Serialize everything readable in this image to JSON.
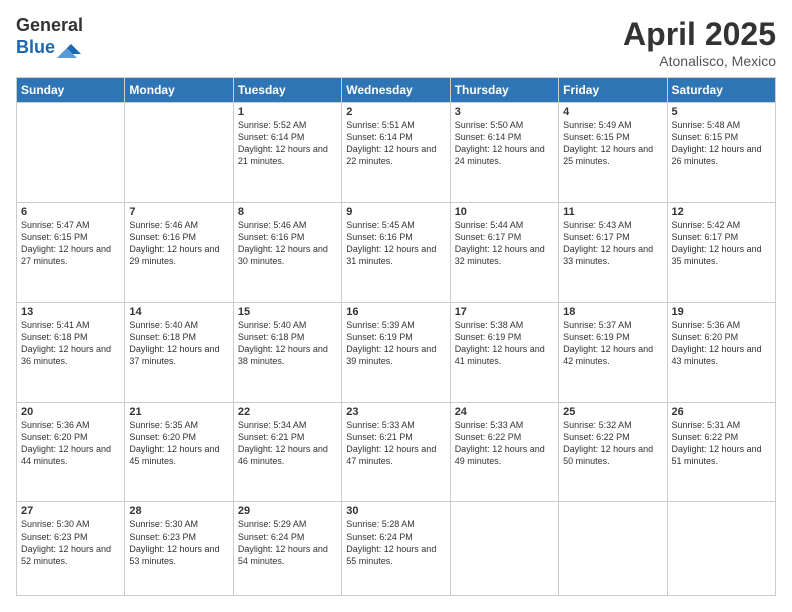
{
  "logo": {
    "general": "General",
    "blue": "Blue"
  },
  "title": {
    "month": "April 2025",
    "location": "Atonalisco, Mexico"
  },
  "weekdays": [
    "Sunday",
    "Monday",
    "Tuesday",
    "Wednesday",
    "Thursday",
    "Friday",
    "Saturday"
  ],
  "weeks": [
    [
      {
        "day": "",
        "info": ""
      },
      {
        "day": "",
        "info": ""
      },
      {
        "day": "1",
        "info": "Sunrise: 5:52 AM\nSunset: 6:14 PM\nDaylight: 12 hours and 21 minutes."
      },
      {
        "day": "2",
        "info": "Sunrise: 5:51 AM\nSunset: 6:14 PM\nDaylight: 12 hours and 22 minutes."
      },
      {
        "day": "3",
        "info": "Sunrise: 5:50 AM\nSunset: 6:14 PM\nDaylight: 12 hours and 24 minutes."
      },
      {
        "day": "4",
        "info": "Sunrise: 5:49 AM\nSunset: 6:15 PM\nDaylight: 12 hours and 25 minutes."
      },
      {
        "day": "5",
        "info": "Sunrise: 5:48 AM\nSunset: 6:15 PM\nDaylight: 12 hours and 26 minutes."
      }
    ],
    [
      {
        "day": "6",
        "info": "Sunrise: 5:47 AM\nSunset: 6:15 PM\nDaylight: 12 hours and 27 minutes."
      },
      {
        "day": "7",
        "info": "Sunrise: 5:46 AM\nSunset: 6:16 PM\nDaylight: 12 hours and 29 minutes."
      },
      {
        "day": "8",
        "info": "Sunrise: 5:46 AM\nSunset: 6:16 PM\nDaylight: 12 hours and 30 minutes."
      },
      {
        "day": "9",
        "info": "Sunrise: 5:45 AM\nSunset: 6:16 PM\nDaylight: 12 hours and 31 minutes."
      },
      {
        "day": "10",
        "info": "Sunrise: 5:44 AM\nSunset: 6:17 PM\nDaylight: 12 hours and 32 minutes."
      },
      {
        "day": "11",
        "info": "Sunrise: 5:43 AM\nSunset: 6:17 PM\nDaylight: 12 hours and 33 minutes."
      },
      {
        "day": "12",
        "info": "Sunrise: 5:42 AM\nSunset: 6:17 PM\nDaylight: 12 hours and 35 minutes."
      }
    ],
    [
      {
        "day": "13",
        "info": "Sunrise: 5:41 AM\nSunset: 6:18 PM\nDaylight: 12 hours and 36 minutes."
      },
      {
        "day": "14",
        "info": "Sunrise: 5:40 AM\nSunset: 6:18 PM\nDaylight: 12 hours and 37 minutes."
      },
      {
        "day": "15",
        "info": "Sunrise: 5:40 AM\nSunset: 6:18 PM\nDaylight: 12 hours and 38 minutes."
      },
      {
        "day": "16",
        "info": "Sunrise: 5:39 AM\nSunset: 6:19 PM\nDaylight: 12 hours and 39 minutes."
      },
      {
        "day": "17",
        "info": "Sunrise: 5:38 AM\nSunset: 6:19 PM\nDaylight: 12 hours and 41 minutes."
      },
      {
        "day": "18",
        "info": "Sunrise: 5:37 AM\nSunset: 6:19 PM\nDaylight: 12 hours and 42 minutes."
      },
      {
        "day": "19",
        "info": "Sunrise: 5:36 AM\nSunset: 6:20 PM\nDaylight: 12 hours and 43 minutes."
      }
    ],
    [
      {
        "day": "20",
        "info": "Sunrise: 5:36 AM\nSunset: 6:20 PM\nDaylight: 12 hours and 44 minutes."
      },
      {
        "day": "21",
        "info": "Sunrise: 5:35 AM\nSunset: 6:20 PM\nDaylight: 12 hours and 45 minutes."
      },
      {
        "day": "22",
        "info": "Sunrise: 5:34 AM\nSunset: 6:21 PM\nDaylight: 12 hours and 46 minutes."
      },
      {
        "day": "23",
        "info": "Sunrise: 5:33 AM\nSunset: 6:21 PM\nDaylight: 12 hours and 47 minutes."
      },
      {
        "day": "24",
        "info": "Sunrise: 5:33 AM\nSunset: 6:22 PM\nDaylight: 12 hours and 49 minutes."
      },
      {
        "day": "25",
        "info": "Sunrise: 5:32 AM\nSunset: 6:22 PM\nDaylight: 12 hours and 50 minutes."
      },
      {
        "day": "26",
        "info": "Sunrise: 5:31 AM\nSunset: 6:22 PM\nDaylight: 12 hours and 51 minutes."
      }
    ],
    [
      {
        "day": "27",
        "info": "Sunrise: 5:30 AM\nSunset: 6:23 PM\nDaylight: 12 hours and 52 minutes."
      },
      {
        "day": "28",
        "info": "Sunrise: 5:30 AM\nSunset: 6:23 PM\nDaylight: 12 hours and 53 minutes."
      },
      {
        "day": "29",
        "info": "Sunrise: 5:29 AM\nSunset: 6:24 PM\nDaylight: 12 hours and 54 minutes."
      },
      {
        "day": "30",
        "info": "Sunrise: 5:28 AM\nSunset: 6:24 PM\nDaylight: 12 hours and 55 minutes."
      },
      {
        "day": "",
        "info": ""
      },
      {
        "day": "",
        "info": ""
      },
      {
        "day": "",
        "info": ""
      }
    ]
  ]
}
